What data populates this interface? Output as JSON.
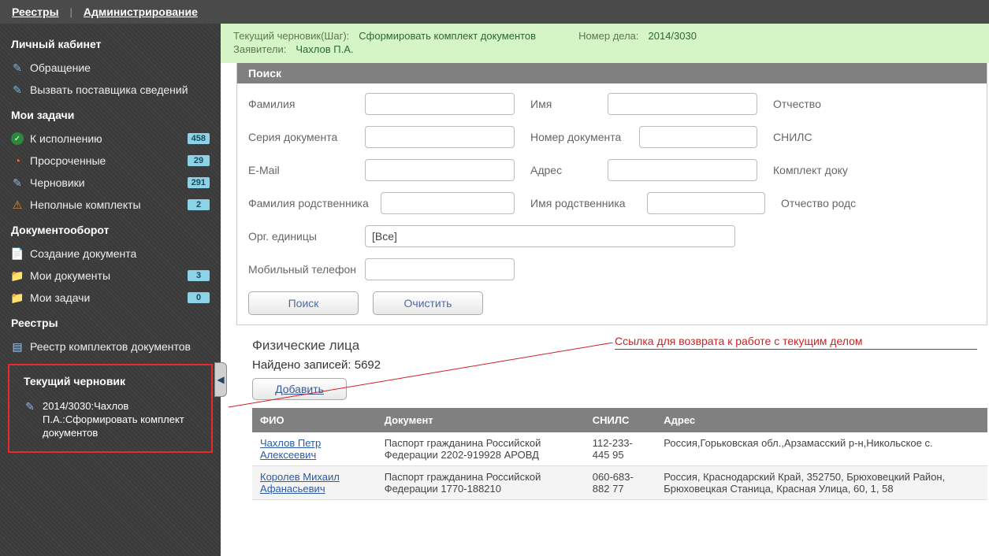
{
  "topnav": {
    "registries": "Реестры",
    "admin": "Администрирование"
  },
  "sidebar": {
    "cabinet_title": "Личный кабинет",
    "cabinet": [
      {
        "icon": "doc-edit",
        "label": "Обращение"
      },
      {
        "icon": "doc-edit",
        "label": "Вызвать поставщика сведений"
      }
    ],
    "tasks_title": "Мои задачи",
    "tasks": [
      {
        "icon": "check",
        "label": "К исполнению",
        "badge": "458"
      },
      {
        "icon": "clock",
        "label": "Просроченные",
        "badge": "29"
      },
      {
        "icon": "draft",
        "label": "Черновики",
        "badge": "291"
      },
      {
        "icon": "warn",
        "label": "Неполные комплекты",
        "badge": "2"
      }
    ],
    "docflow_title": "Документооборот",
    "docflow": [
      {
        "icon": "newdoc",
        "label": "Создание документа",
        "badge": ""
      },
      {
        "icon": "folder",
        "label": "Мои документы",
        "badge": "3"
      },
      {
        "icon": "folder-red",
        "label": "Мои задачи",
        "badge": "0"
      }
    ],
    "registries_title": "Реестры",
    "registries": [
      {
        "icon": "list",
        "label": "Реестр комплектов документов"
      }
    ],
    "current_title": "Текущий черновик",
    "current_item": "2014/3030:Чахлов П.А.:Сформировать комплект документов"
  },
  "infoband": {
    "step_label": "Текущий черновик(Шаг):",
    "step_value": "Сформировать комплект документов",
    "case_label": "Номер дела:",
    "case_value": "2014/3030",
    "applicants_label": "Заявители:",
    "applicants_value": "Чахлов П.А."
  },
  "search": {
    "title": "Поиск",
    "fields": {
      "surname": "Фамилия",
      "name": "Имя",
      "patronymic": "Отчество",
      "doc_series": "Серия документа",
      "doc_number": "Номер документа",
      "snils": "СНИЛС",
      "email": "E-Mail",
      "address": "Адрес",
      "packet": "Комплект доку",
      "rel_surname": "Фамилия родственника",
      "rel_name": "Имя родственника",
      "rel_patronymic": "Отчество родс",
      "org_units": "Орг. единицы",
      "org_value": "[Все]",
      "phone": "Мобильный телефон"
    },
    "btn_search": "Поиск",
    "btn_clear": "Очистить"
  },
  "results": {
    "heading": "Физические лица",
    "found_label": "Найдено записей: ",
    "found_count": "5692",
    "btn_add": "Добавить",
    "annotation": "Ссылка для возврата к работе с текущим делом",
    "columns": [
      "ФИО",
      "Документ",
      "СНИЛС",
      "Адрес"
    ],
    "rows": [
      {
        "fio": "Чахлов Петр Алексеевич",
        "doc": "Паспорт гражданина Российской Федерации 2202-919928 АРОВД",
        "snils": "112-233-445 95",
        "addr": "Россия,Горьковская обл.,Арзамасский р-н,Никольское с."
      },
      {
        "fio": "Королев Михаил Афанасьевич",
        "doc": "Паспорт гражданина Российской Федерации 1770-188210",
        "snils": "060-683-882 77",
        "addr": "Россия, Краснодарский Край, 352750, Брюховецкий Район, Брюховецкая Станица, Красная Улица, 60, 1, 58"
      }
    ]
  }
}
